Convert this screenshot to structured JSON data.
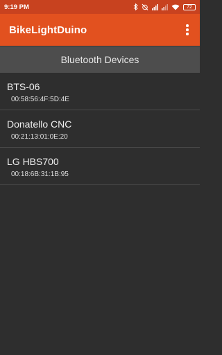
{
  "status_bar": {
    "time": "9:19 PM",
    "battery": "72",
    "icons": [
      "bluetooth-icon",
      "alarm-off-icon",
      "signal-icon",
      "signal-icon",
      "wifi-icon",
      "battery-icon"
    ]
  },
  "app_bar": {
    "title": "BikeLightDuino",
    "menu_icon": "overflow-menu-icon"
  },
  "section": {
    "title": "Bluetooth Devices"
  },
  "devices": [
    {
      "name": "BTS-06",
      "address": "00:58:56:4F:5D:4E"
    },
    {
      "name": "Donatello CNC",
      "address": "00:21:13:01:0E:20"
    },
    {
      "name": "LG HBS700",
      "address": "00:18:6B:31:1B:95"
    }
  ],
  "colors": {
    "status_bar": "#c8421f",
    "app_bar": "#e2511f",
    "header": "#4d4d4d",
    "background": "#2e2e2e"
  }
}
